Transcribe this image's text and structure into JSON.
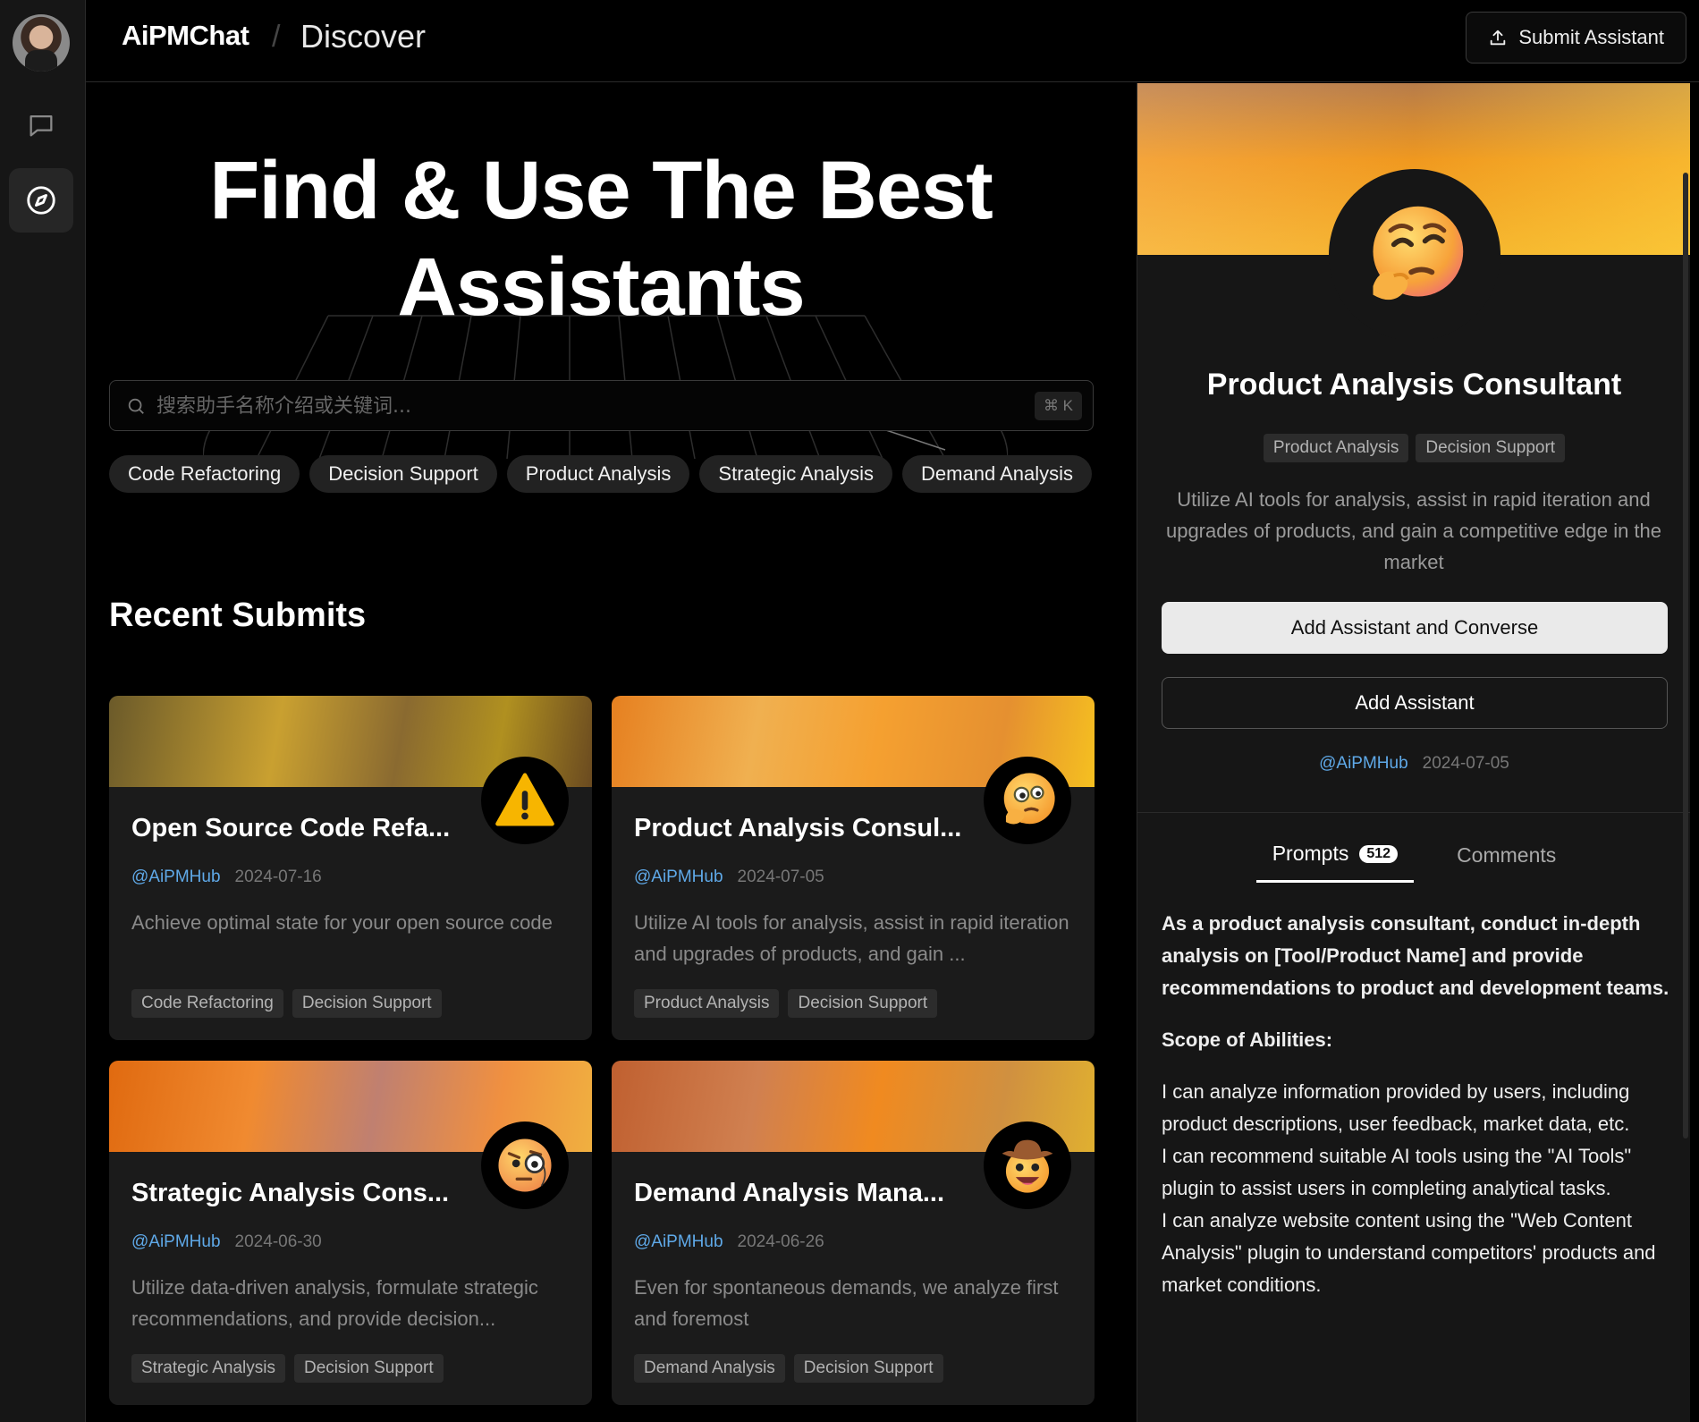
{
  "header": {
    "brand": "AiPMChat",
    "breadcrumb_sep": "/",
    "page": "Discover",
    "submit_label": "Submit Assistant"
  },
  "hero": {
    "title_line1": "Find & Use The Best",
    "title_line2": "Assistants"
  },
  "search": {
    "placeholder": "搜索助手名称介绍或关键词...",
    "value": "",
    "shortcut": "⌘ K"
  },
  "tags": [
    "Code Refactoring",
    "Decision Support",
    "Product Analysis",
    "Strategic Analysis",
    "Demand Analysis"
  ],
  "recent": {
    "title": "Recent Submits",
    "cards": [
      {
        "title": "Open Source Code Refa...",
        "author": "@AiPMHub",
        "date": "2024-07-16",
        "desc": "Achieve optimal state for your open source code",
        "tags": [
          "Code Refactoring",
          "Decision Support"
        ],
        "icon": "warning-emoji"
      },
      {
        "title": "Product Analysis Consul...",
        "author": "@AiPMHub",
        "date": "2024-07-05",
        "desc": "Utilize AI tools for analysis, assist in rapid iteration and upgrades of products, and gain ...",
        "tags": [
          "Product Analysis",
          "Decision Support"
        ],
        "icon": "thinking-face-monocle-emoji"
      },
      {
        "title": "Strategic Analysis Cons...",
        "author": "@AiPMHub",
        "date": "2024-06-30",
        "desc": "Utilize data-driven analysis, formulate strategic recommendations, and provide decision...",
        "tags": [
          "Strategic Analysis",
          "Decision Support"
        ],
        "icon": "face-with-monocle-emoji"
      },
      {
        "title": "Demand Analysis Mana...",
        "author": "@AiPMHub",
        "date": "2024-06-26",
        "desc": "Even for spontaneous demands, we analyze first and foremost",
        "tags": [
          "Demand Analysis",
          "Decision Support"
        ],
        "icon": "cowboy-face-emoji"
      }
    ]
  },
  "detail": {
    "title": "Product Analysis Consultant",
    "tags": [
      "Product Analysis",
      "Decision Support"
    ],
    "desc": "Utilize AI tools for analysis, assist in rapid iteration and upgrades of products, and gain a competitive edge in the market",
    "primary_label": "Add Assistant and Converse",
    "secondary_label": "Add Assistant",
    "author": "@AiPMHub",
    "date": "2024-07-05",
    "tab_prompts": "Prompts",
    "prompt_count": "512",
    "tab_comments": "Comments",
    "prompt_lead": "As a product analysis consultant, conduct in-depth analysis on [Tool/Product Name] and provide recommendations to product and development teams.",
    "scope_title": "Scope of Abilities:",
    "abilities": [
      "I can analyze information provided by users, including product descriptions, user feedback, market data, etc.",
      "I can recommend suitable AI tools using the \"AI Tools\" plugin to assist users in completing analytical tasks.",
      "I can analyze website content using the \"Web Content Analysis\" plugin to understand competitors' products and market conditions."
    ]
  },
  "colors": {
    "background": "#000000",
    "panel": "#161616",
    "card": "#1b1b1b",
    "accent_link": "#5fa9e8"
  }
}
